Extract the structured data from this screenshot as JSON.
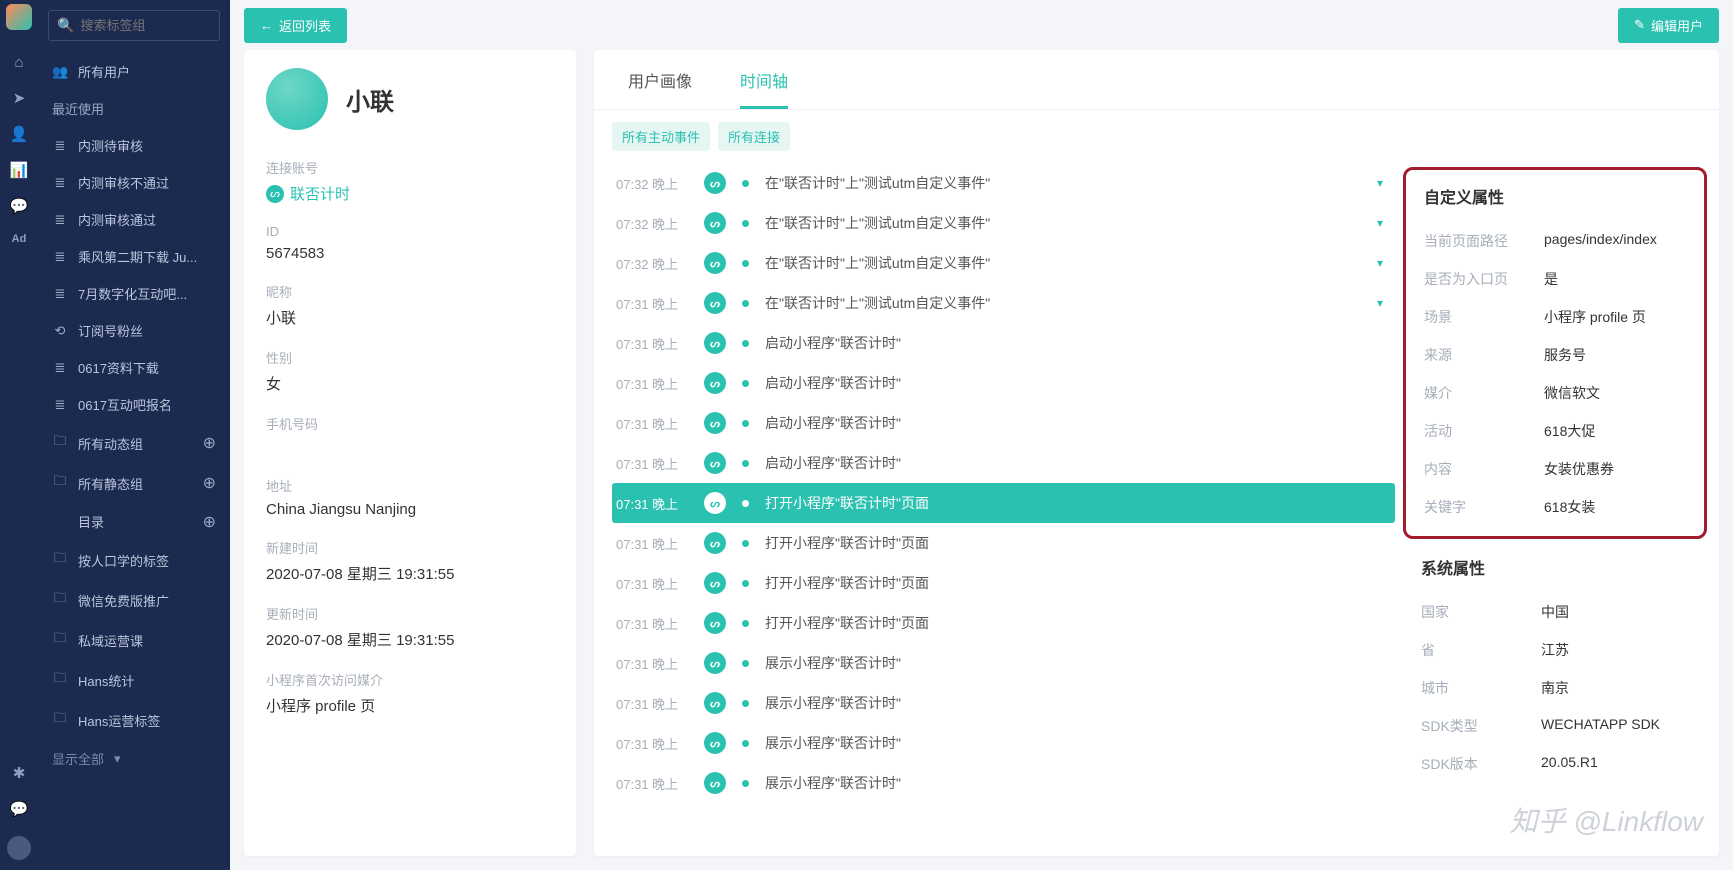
{
  "rail": [
    "home",
    "send",
    "user",
    "chart",
    "chat",
    "ad"
  ],
  "search_placeholder": "搜索标签组",
  "sidebar": {
    "all_users": "所有用户",
    "recent_heading": "最近使用",
    "recent_items": [
      {
        "icon": "≣",
        "label": "内测待审核"
      },
      {
        "icon": "≣",
        "label": "内测审核不通过"
      },
      {
        "icon": "≣",
        "label": "内测审核通过"
      },
      {
        "icon": "≣",
        "label": "乘风第二期下载 Ju..."
      },
      {
        "icon": "≣",
        "label": "7月数字化互动吧..."
      },
      {
        "icon": "⟲",
        "label": "订阅号粉丝"
      },
      {
        "icon": "≣",
        "label": "0617资料下载"
      },
      {
        "icon": "≣",
        "label": "0617互动吧报名"
      }
    ],
    "groups": [
      {
        "icon": "🗀",
        "label": "所有动态组",
        "plus": true
      },
      {
        "icon": "🗀",
        "label": "所有静态组",
        "plus": true
      },
      {
        "icon": "",
        "label": "目录",
        "plus": true
      }
    ],
    "folders": [
      {
        "label": "按人口学的标签"
      },
      {
        "label": "微信免费版推广"
      },
      {
        "label": "私域运营课"
      },
      {
        "label": "Hans统计"
      },
      {
        "label": "Hans运营标签"
      }
    ],
    "show_all": "显示全部"
  },
  "topbar": {
    "back": "返回列表",
    "edit": "编辑用户"
  },
  "profile": {
    "name": "小联",
    "fields": [
      {
        "lab": "连接账号",
        "val": "联否计时",
        "acct": true
      },
      {
        "lab": "ID",
        "val": "5674583"
      },
      {
        "lab": "昵称",
        "val": "小联"
      },
      {
        "lab": "性别",
        "val": "女"
      },
      {
        "lab": "手机号码",
        "val": ""
      },
      {
        "lab": "地址",
        "val": "China Jiangsu Nanjing"
      },
      {
        "lab": "新建时间",
        "val": "2020-07-08 星期三 19:31:55"
      },
      {
        "lab": "更新时间",
        "val": "2020-07-08 星期三 19:31:55"
      },
      {
        "lab": "小程序首次访问媒介",
        "val": "小程序 profile 页"
      }
    ]
  },
  "tabs": {
    "portrait": "用户画像",
    "timeline": "时间轴"
  },
  "filters": [
    "所有主动事件",
    "所有连接"
  ],
  "events": [
    {
      "time": "07:32 晚上",
      "txt": "在\"联否计时\"上\"测试utm自定义事件\"",
      "caret": true
    },
    {
      "time": "07:32 晚上",
      "txt": "在\"联否计时\"上\"测试utm自定义事件\"",
      "caret": true
    },
    {
      "time": "07:32 晚上",
      "txt": "在\"联否计时\"上\"测试utm自定义事件\"",
      "caret": true
    },
    {
      "time": "07:31 晚上",
      "txt": "在\"联否计时\"上\"测试utm自定义事件\"",
      "caret": true
    },
    {
      "time": "07:31 晚上",
      "txt": "启动小程序\"联否计时\""
    },
    {
      "time": "07:31 晚上",
      "txt": "启动小程序\"联否计时\""
    },
    {
      "time": "07:31 晚上",
      "txt": "启动小程序\"联否计时\""
    },
    {
      "time": "07:31 晚上",
      "txt": "启动小程序\"联否计时\""
    },
    {
      "time": "07:31 晚上",
      "txt": "打开小程序\"联否计时\"页面",
      "sel": true
    },
    {
      "time": "07:31 晚上",
      "txt": "打开小程序\"联否计时\"页面"
    },
    {
      "time": "07:31 晚上",
      "txt": "打开小程序\"联否计时\"页面"
    },
    {
      "time": "07:31 晚上",
      "txt": "打开小程序\"联否计时\"页面"
    },
    {
      "time": "07:31 晚上",
      "txt": "展示小程序\"联否计时\""
    },
    {
      "time": "07:31 晚上",
      "txt": "展示小程序\"联否计时\""
    },
    {
      "time": "07:31 晚上",
      "txt": "展示小程序\"联否计时\""
    },
    {
      "time": "07:31 晚上",
      "txt": "展示小程序\"联否计时\""
    }
  ],
  "detail": {
    "custom_title": "自定义属性",
    "custom": [
      {
        "k": "当前页面路径",
        "v": "pages/index/index"
      },
      {
        "k": "是否为入口页",
        "v": "是"
      },
      {
        "k": "场景",
        "v": "小程序 profile 页"
      },
      {
        "k": "来源",
        "v": "服务号"
      },
      {
        "k": "媒介",
        "v": "微信软文"
      },
      {
        "k": "活动",
        "v": "618大促"
      },
      {
        "k": "内容",
        "v": "女装优惠券"
      },
      {
        "k": "关键字",
        "v": "618女装"
      }
    ],
    "sys_title": "系统属性",
    "sys": [
      {
        "k": "国家",
        "v": "中国"
      },
      {
        "k": "省",
        "v": "江苏"
      },
      {
        "k": "城市",
        "v": "南京"
      },
      {
        "k": "SDK类型",
        "v": "WECHATAPP SDK"
      },
      {
        "k": "SDK版本",
        "v": "20.05.R1"
      }
    ]
  },
  "watermark": "知乎 @Linkflow"
}
